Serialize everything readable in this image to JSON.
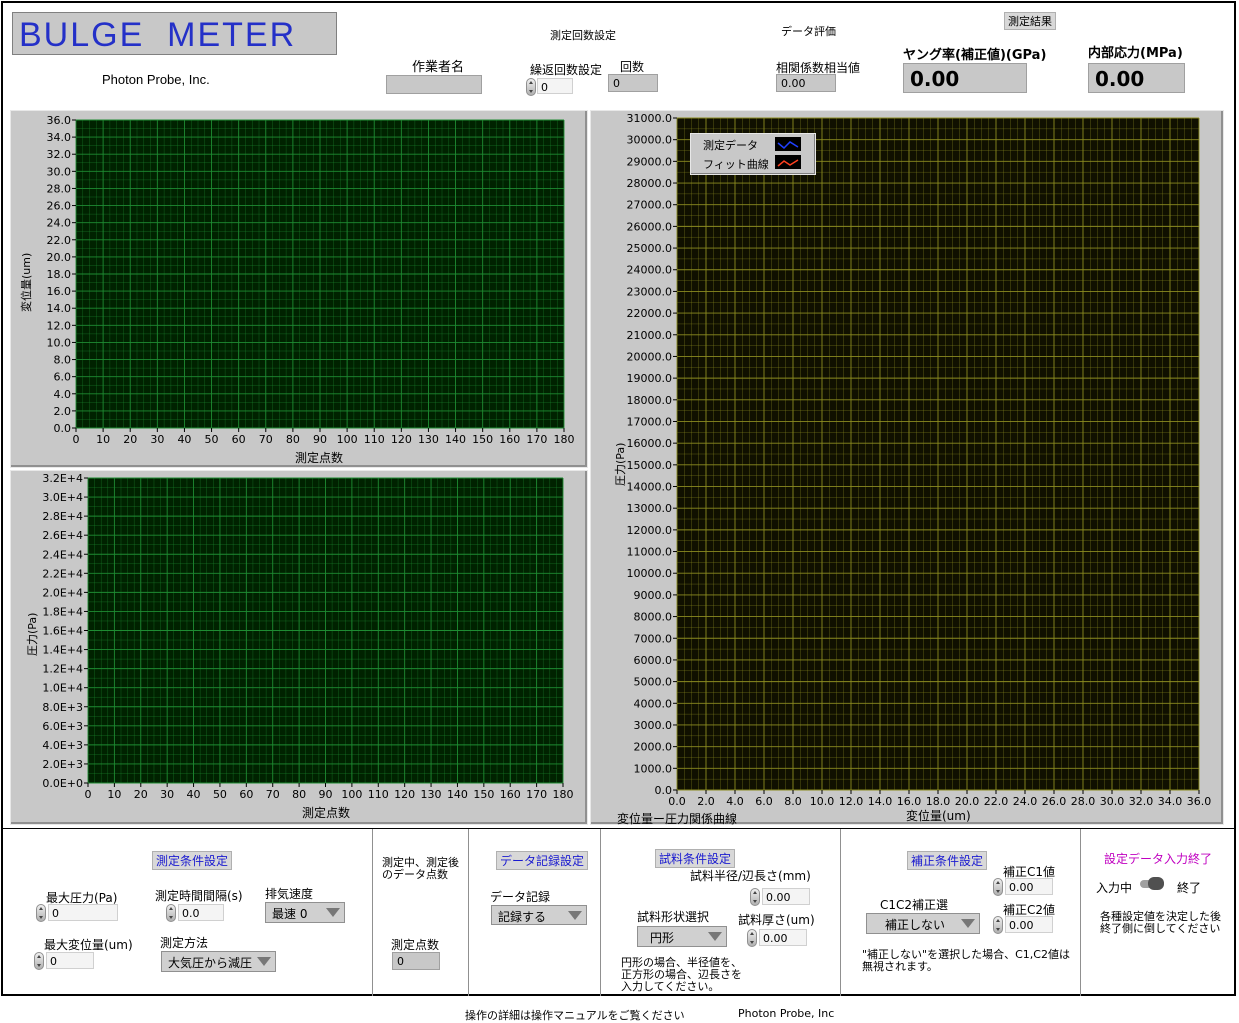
{
  "header": {
    "title": "BULGE  METER",
    "company": "Photon Probe, Inc.",
    "operator_label": "作業者名",
    "operator_value": "",
    "repeat_section_label": "測定回数設定",
    "repeat_setting_label": "繰返回数設定",
    "repeat_setting_value": "0",
    "count_label": "回数",
    "count_value": "0",
    "eval_section_label": "データ評価",
    "corr_label": "相関係数相当値",
    "corr_value": "0.00",
    "result_section_label": "測定結果",
    "young_label": "ヤング率(補正値)(GPa)",
    "young_value": "0.00",
    "stress_label": "内部応力(MPa)",
    "stress_value": "0.00"
  },
  "graph_displacement": {
    "ylabel": "変位量(um)",
    "xlabel": "測定点数",
    "y_ticks": [
      "36.0",
      "34.0",
      "32.0",
      "30.0",
      "28.0",
      "26.0",
      "24.0",
      "22.0",
      "20.0",
      "18.0",
      "16.0",
      "14.0",
      "12.0",
      "10.0",
      "8.0",
      "6.0",
      "4.0",
      "2.0",
      "0.0"
    ],
    "x_ticks": [
      "0",
      "10",
      "20",
      "30",
      "40",
      "50",
      "60",
      "70",
      "80",
      "90",
      "100",
      "110",
      "120",
      "130",
      "140",
      "150",
      "160",
      "170",
      "180"
    ],
    "grid_color": "#1e8c32",
    "bg_color": "#002200"
  },
  "graph_pressure": {
    "ylabel": "圧力(Pa)",
    "xlabel": "測定点数",
    "y_ticks": [
      "3.2E+4",
      "3.0E+4",
      "2.8E+4",
      "2.6E+4",
      "2.4E+4",
      "2.2E+4",
      "2.0E+4",
      "1.8E+4",
      "1.6E+4",
      "1.4E+4",
      "1.2E+4",
      "1.0E+4",
      "8.0E+3",
      "6.0E+3",
      "4.0E+3",
      "2.0E+3",
      "0.0E+0"
    ],
    "x_ticks": [
      "0",
      "10",
      "20",
      "30",
      "40",
      "50",
      "60",
      "70",
      "80",
      "90",
      "100",
      "110",
      "120",
      "130",
      "140",
      "150",
      "160",
      "170",
      "180"
    ],
    "grid_color": "#1e8c32",
    "bg_color": "#002200"
  },
  "graph_relation": {
    "ylabel": "圧力(Pa)",
    "xlabel": "変位量(um)",
    "caption": "変位量ー圧力関係曲線",
    "y_ticks": [
      "31000.0",
      "30000.0",
      "29000.0",
      "28000.0",
      "27000.0",
      "26000.0",
      "25000.0",
      "24000.0",
      "23000.0",
      "22000.0",
      "21000.0",
      "20000.0",
      "19000.0",
      "18000.0",
      "17000.0",
      "16000.0",
      "15000.0",
      "14000.0",
      "13000.0",
      "12000.0",
      "11000.0",
      "10000.0",
      "9000.0",
      "8000.0",
      "7000.0",
      "6000.0",
      "5000.0",
      "4000.0",
      "3000.0",
      "2000.0",
      "1000.0",
      "0.0"
    ],
    "x_ticks": [
      "0.0",
      "2.0",
      "4.0",
      "6.0",
      "8.0",
      "10.0",
      "12.0",
      "14.0",
      "16.0",
      "18.0",
      "20.0",
      "22.0",
      "24.0",
      "26.0",
      "28.0",
      "30.0",
      "32.0",
      "34.0",
      "36.0"
    ],
    "legend": [
      "測定データ",
      "フィット曲線"
    ],
    "legend_colors": [
      "#2040ff",
      "#ff4020"
    ],
    "grid_color": "#8c8c20",
    "bg_color": "#101000"
  },
  "measure_conditions": {
    "title": "測定条件設定",
    "max_pressure_label": "最大圧力(Pa)",
    "max_pressure_value": "0",
    "interval_label": "測定時間間隔(s)",
    "interval_value": "0.0",
    "exhaust_label": "排気速度",
    "exhaust_value": "最速 0",
    "max_disp_label": "最大変位量(um)",
    "max_disp_value": "0",
    "method_label": "測定方法",
    "method_value": "大気圧から減圧"
  },
  "points": {
    "title": "測定中、測定後のデータ点数",
    "label": "測定点数",
    "value": "0"
  },
  "data_record": {
    "title": "データ記録設定",
    "label": "データ記録",
    "value": "記録する"
  },
  "sample_conditions": {
    "title": "試料条件設定",
    "radius_label": "試料半径/辺長さ(mm)",
    "radius_value": "0.00",
    "shape_label": "試料形状選択",
    "shape_value": "円形",
    "thickness_label": "試料厚さ(um)",
    "thickness_value": "0.00",
    "note": "円形の場合、半径値を、正方形の場合、辺長さを入力してください。"
  },
  "correction": {
    "title": "補正条件設定",
    "select_label": "C1C2補正選",
    "select_value": "補正しない",
    "c1_label": "補正C1値",
    "c1_value": "0.00",
    "c2_label": "補正C2値",
    "c2_value": "0.00",
    "note": "\"補正しない\"を選択した場合、C1,C2値は無視されます。"
  },
  "finish": {
    "title": "設定データ入力終了",
    "left_label": "入力中",
    "right_label": "終了",
    "note": "各種設定値を決定した後終了側に倒してください"
  },
  "footer": {
    "manual_note": "操作の詳細は操作マニュアルをご覧ください",
    "company": "Photon Probe, Inc"
  }
}
